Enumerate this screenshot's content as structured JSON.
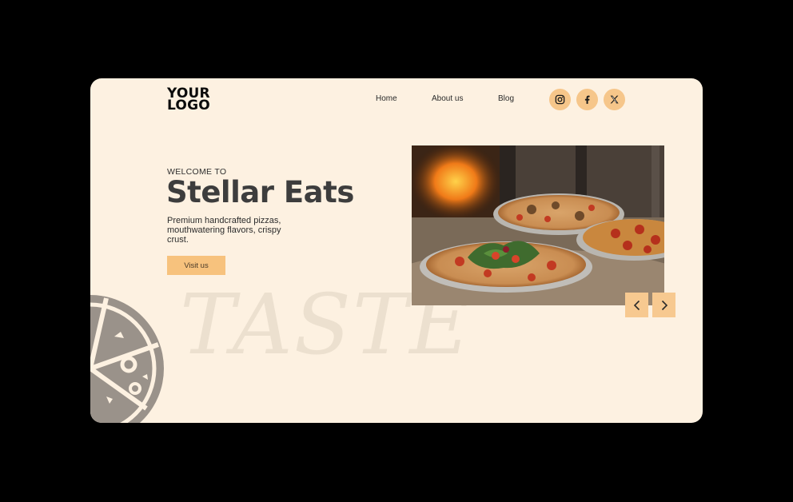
{
  "header": {
    "logo_line1": "YOUR",
    "logo_line2": "LOGO",
    "nav": [
      {
        "label": "Home"
      },
      {
        "label": "About us"
      },
      {
        "label": "Blog"
      }
    ],
    "social": [
      {
        "icon": "instagram-icon"
      },
      {
        "icon": "facebook-icon"
      },
      {
        "icon": "x-icon"
      }
    ]
  },
  "hero": {
    "eyebrow": "WELCOME TO",
    "title": "Stellar Eats",
    "description": "Premium handcrafted pizzas, mouthwatering flavors, crispy crust.",
    "cta_label": "Visit us",
    "watermark": "TASTE"
  },
  "carousel": {
    "prev_icon": "chevron-left-icon",
    "next_icon": "chevron-right-icon"
  },
  "colors": {
    "background": "#fdf1e1",
    "accent": "#f7c27d",
    "text_dark": "#3d3d3d"
  }
}
